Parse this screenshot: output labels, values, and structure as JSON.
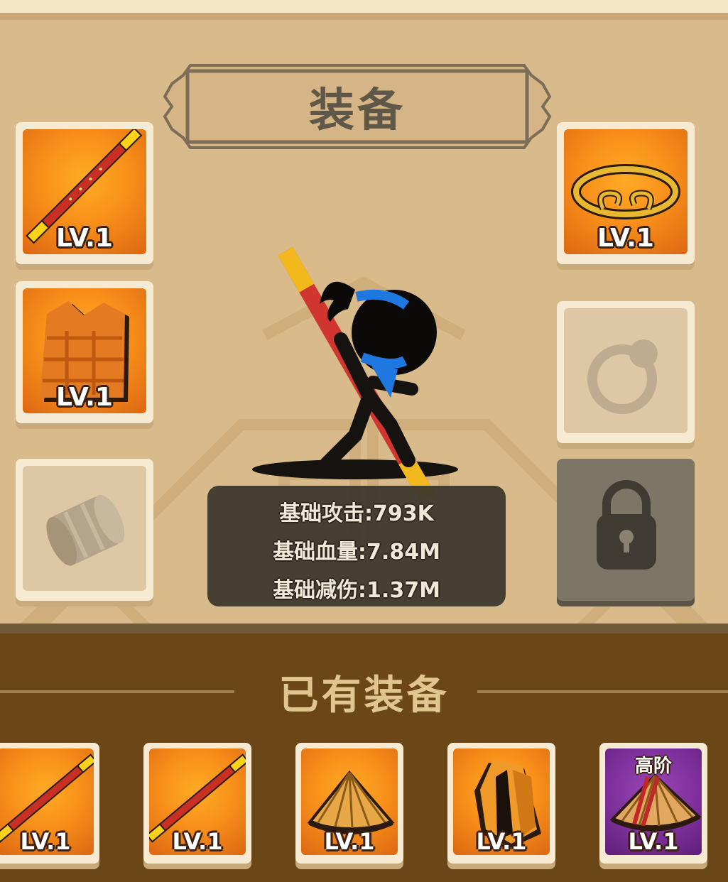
{
  "equipment_panel": {
    "title": "装备",
    "slots": [
      {
        "icon": "golden-staff-icon",
        "level": "LV.1"
      },
      {
        "icon": "golden-circlet-icon",
        "level": "LV.1"
      },
      {
        "icon": "armor-vest-icon",
        "level": "LV.1"
      },
      {
        "icon": "ring-icon",
        "level": ""
      },
      {
        "icon": "bracer-icon",
        "level": ""
      },
      {
        "icon": "lock-icon",
        "level": ""
      }
    ],
    "stats": [
      "基础攻击:793K",
      "基础血量:7.84M",
      "基础减伤:1.37M"
    ]
  },
  "owned_panel": {
    "title": "已有装备",
    "items": [
      {
        "icon": "golden-staff-icon",
        "level": "LV.1",
        "tier": ""
      },
      {
        "icon": "golden-staff-icon",
        "level": "LV.1",
        "tier": ""
      },
      {
        "icon": "straw-hat-icon",
        "level": "LV.1",
        "tier": ""
      },
      {
        "icon": "cloak-icon",
        "level": "LV.1",
        "tier": ""
      },
      {
        "icon": "straw-hat-icon",
        "level": "LV.1",
        "tier": "高阶"
      }
    ]
  },
  "colors": {
    "upper_bg": "#d9ba8b",
    "lower_bg": "#6b4718",
    "slot_orange": "#f8901a",
    "slot_purple": "#7b2d98",
    "stats_bg": "#3a342c"
  }
}
